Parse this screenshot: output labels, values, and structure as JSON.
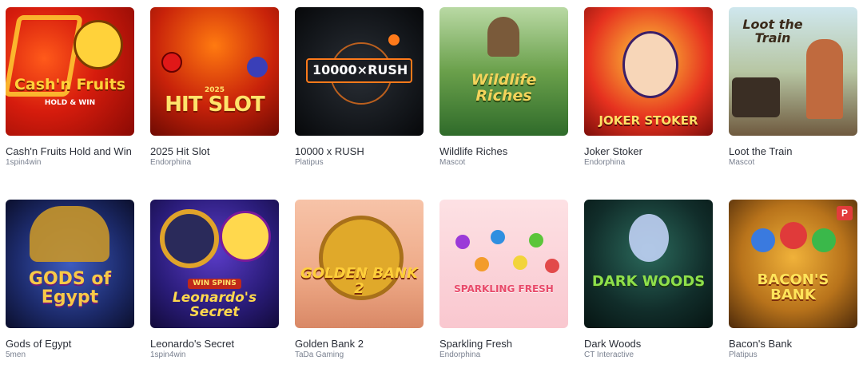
{
  "games": [
    {
      "title": "Cash'n Fruits Hold and Win",
      "provider": "1spin4win",
      "logo": "Cash'n Fruits",
      "logo_sub": "HOLD & WIN",
      "icon": "slot-seven-icon",
      "accent": "#ffd23a",
      "badge": ""
    },
    {
      "title": "2025 Hit Slot",
      "provider": "Endorphina",
      "logo": "HIT SLOT",
      "logo_sub": "2025",
      "icon": "cherry-icon",
      "accent": "#ffe36b",
      "badge": ""
    },
    {
      "title": "10000 x RUSH",
      "provider": "Platipus",
      "logo": "10000×RUSH",
      "logo_sub": "",
      "icon": "target-icon",
      "accent": "#ff7a1a",
      "badge": ""
    },
    {
      "title": "Wildlife Riches",
      "provider": "Mascot",
      "logo": "Wildlife Riches",
      "logo_sub": "",
      "icon": "deer-icon",
      "accent": "#f3d35b",
      "badge": ""
    },
    {
      "title": "Joker Stoker",
      "provider": "Endorphina",
      "logo": "JOKER STOKER",
      "logo_sub": "",
      "icon": "joker-icon",
      "accent": "#ffe066",
      "badge": ""
    },
    {
      "title": "Loot the Train",
      "provider": "Mascot",
      "logo": "Loot the Train",
      "logo_sub": "",
      "icon": "train-icon",
      "accent": "#3a2a1a",
      "badge": ""
    },
    {
      "title": "Gods of Egypt",
      "provider": "5men",
      "logo": "GODS of Egypt",
      "logo_sub": "",
      "icon": "pharaoh-icon",
      "accent": "#f7c948",
      "badge": ""
    },
    {
      "title": "Leonardo's Secret",
      "provider": "1spin4win",
      "logo": "Leonardo's Secret",
      "logo_sub": "WIN SPINS",
      "icon": "gem-icon",
      "accent": "#ffd84d",
      "badge": ""
    },
    {
      "title": "Golden Bank 2",
      "provider": "TaDa Gaming",
      "logo": "GOLDEN BANK 2",
      "logo_sub": "",
      "icon": "vault-icon",
      "accent": "#ffcf3a",
      "badge": ""
    },
    {
      "title": "Sparkling Fresh",
      "provider": "Endorphina",
      "logo": "SPARKLING FRESH",
      "logo_sub": "",
      "icon": "fruit-icon",
      "accent": "#e84a6a",
      "badge": ""
    },
    {
      "title": "Dark Woods",
      "provider": "CT Interactive",
      "logo": "DARK WOODS",
      "logo_sub": "",
      "icon": "fairy-icon",
      "accent": "#8fe04a",
      "badge": ""
    },
    {
      "title": "Bacon's Bank",
      "provider": "Platipus",
      "logo": "BACON'S BANK",
      "logo_sub": "",
      "icon": "pig-icon",
      "accent": "#ffe45a",
      "badge": "P"
    }
  ]
}
